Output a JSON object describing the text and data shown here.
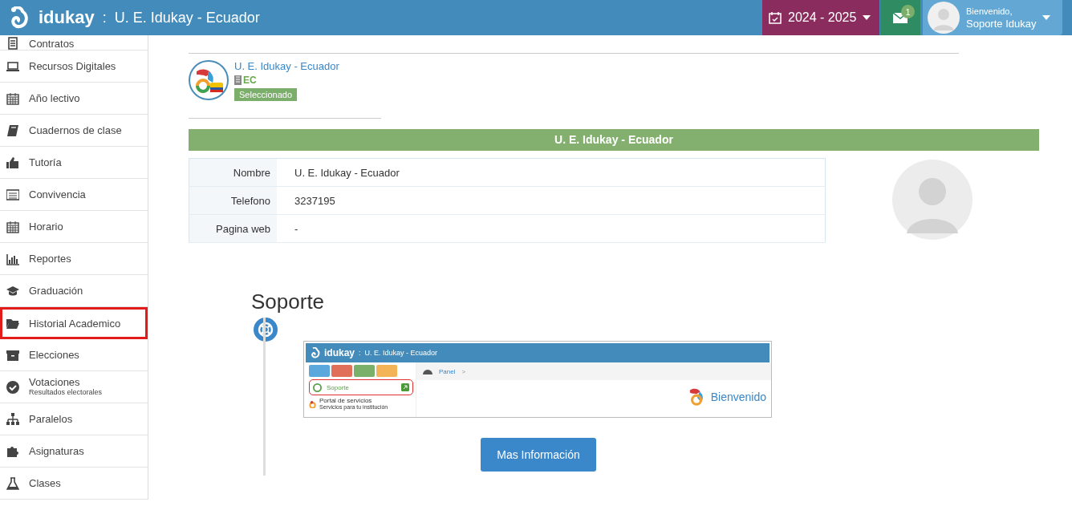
{
  "header": {
    "brand": "idukay",
    "separator": ":",
    "school": "U. E. Idukay - Ecuador",
    "year": "2024 - 2025",
    "messages_count": "1",
    "welcome": "Bienvenido,",
    "user": "Soporte Idukay"
  },
  "sidebar": {
    "items": [
      {
        "label": "Contratos",
        "selected": false
      },
      {
        "label": "Recursos Digitales",
        "selected": false
      },
      {
        "label": "Año lectivo",
        "selected": false
      },
      {
        "label": "Cuadernos de clase",
        "selected": false
      },
      {
        "label": "Tutoría",
        "selected": false
      },
      {
        "label": "Convivencia",
        "selected": false
      },
      {
        "label": "Horario",
        "selected": false
      },
      {
        "label": "Reportes",
        "selected": false
      },
      {
        "label": "Graduación",
        "selected": false
      },
      {
        "label": "Historial Academico",
        "selected": true
      },
      {
        "label": "Elecciones",
        "selected": false
      },
      {
        "label": "Votaciones",
        "sublabel": "Resultados electorales",
        "selected": false
      },
      {
        "label": "Paralelos",
        "selected": false
      },
      {
        "label": "Asignaturas",
        "selected": false
      },
      {
        "label": "Clases",
        "selected": false
      }
    ]
  },
  "institution": {
    "name": "U. E. Idukay - Ecuador",
    "country": "EC",
    "status": "Seleccionado"
  },
  "details": {
    "title": "U. E. Idukay - Ecuador",
    "rows": [
      {
        "label": "Nombre",
        "value": "U. E. Idukay - Ecuador"
      },
      {
        "label": "Telefono",
        "value": "3237195"
      },
      {
        "label": "Pagina web",
        "value": "-"
      }
    ]
  },
  "support": {
    "title": "Soporte",
    "preview": {
      "brand": "idukay",
      "separator": ":",
      "school": "U. E. Idukay - Ecuador",
      "breadcrumb": "Panel",
      "breadcrumb_sep": ">",
      "menu_item": "Soporte",
      "portal": "Portal de servicios",
      "portal_sub": "Servicios para tu institución",
      "welcome": "Bienvenido"
    },
    "button": "Mas Información"
  }
}
